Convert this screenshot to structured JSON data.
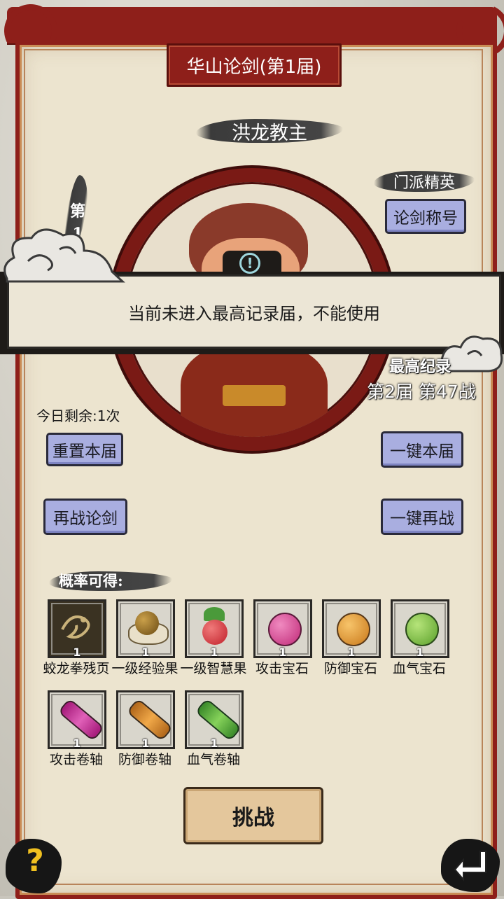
{
  "title": "华山论剑(第1届)",
  "boss_name": "洪龙教主",
  "rank": {
    "line1": "第",
    "line2": "1"
  },
  "sect_label": "门派精英",
  "title_button": "论剑称号",
  "alert": {
    "icon": "!",
    "message": "当前未进入最高记录届，不能使用"
  },
  "record": {
    "label": "最高纪录",
    "value": "第2届 第47战"
  },
  "remaining": "今日剩余:1次",
  "buttons": {
    "reset": "重置本届",
    "one_key_round": "一键本届",
    "fight_again": "再战论剑",
    "one_key_again": "一键再战",
    "challenge": "挑战"
  },
  "rewards_label": "概率可得:",
  "rewards": [
    {
      "name": "蛟龙拳残页",
      "count": "1",
      "icon": "dragon-page-icon",
      "color": "#2a2418"
    },
    {
      "name": "一级经验果",
      "count": "1",
      "icon": "exp-fruit-icon",
      "color": "#7a5a1a"
    },
    {
      "name": "一级智慧果",
      "count": "1",
      "icon": "wisdom-fruit-icon",
      "color": "#d6303a"
    },
    {
      "name": "攻击宝石",
      "count": "1",
      "icon": "attack-gem-icon",
      "color": "#d83c8a"
    },
    {
      "name": "防御宝石",
      "count": "1",
      "icon": "defense-gem-icon",
      "color": "#e39a2a"
    },
    {
      "name": "血气宝石",
      "count": "1",
      "icon": "vitality-gem-icon",
      "color": "#7ac234"
    },
    {
      "name": "攻击卷轴",
      "count": "1",
      "icon": "attack-scroll-icon",
      "color": "#c2369a"
    },
    {
      "name": "防御卷轴",
      "count": "1",
      "icon": "defense-scroll-icon",
      "color": "#d98a2a"
    },
    {
      "name": "血气卷轴",
      "count": "1",
      "icon": "vitality-scroll-icon",
      "color": "#5ab03a"
    }
  ],
  "help_icon": "?",
  "back_icon": "return-arrow-icon"
}
